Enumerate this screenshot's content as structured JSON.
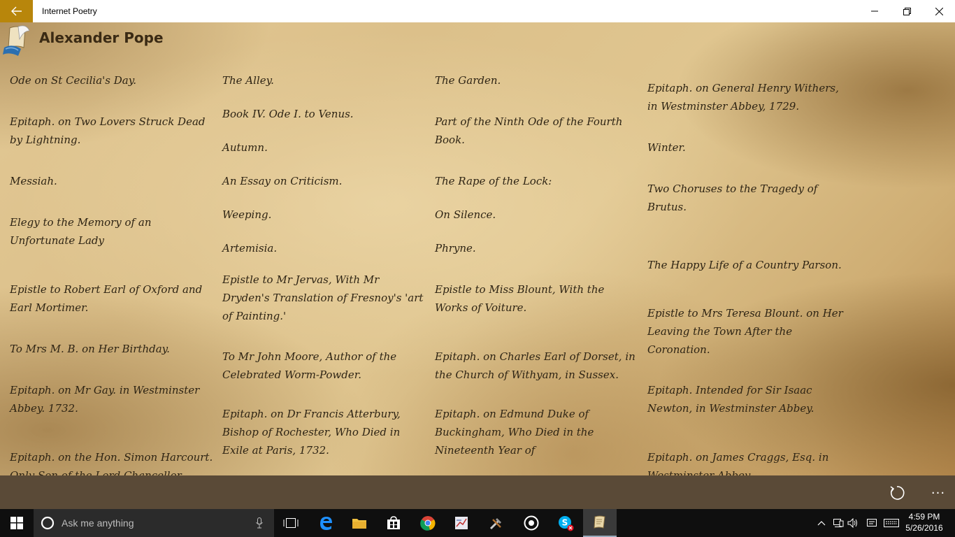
{
  "window": {
    "title": "Internet Poetry"
  },
  "page": {
    "author": "Alexander Pope"
  },
  "columns": [
    [
      {
        "title": "Ode on St Cecilia's Day."
      },
      {
        "title": "Epitaph. on Two Lovers Struck Dead by Lightning."
      },
      {
        "title": "Messiah."
      },
      {
        "title": "Elegy to the Memory of an Unfortunate Lady"
      },
      {
        "title": "Epistle to Robert Earl of Oxford and Earl Mortimer."
      },
      {
        "title": "To Mrs M. B. on Her Birthday."
      },
      {
        "title": "Epitaph. on Mr Gay. in Westminster Abbey. 1732."
      },
      {
        "title": "Epitaph. on the Hon. Simon Harcourt. Only Son of the Lord Chancellor"
      }
    ],
    [
      {
        "title": "The Alley."
      },
      {
        "title": "Book IV. Ode I. to Venus."
      },
      {
        "title": "Autumn."
      },
      {
        "title": "An Essay on Criticism."
      },
      {
        "title": "Weeping."
      },
      {
        "title": "Artemisia."
      },
      {
        "title": "Epistle to Mr Jervas, With Mr Dryden's Translation of Fresnoy's 'art of Painting.'"
      },
      {
        "title": "To Mr John Moore, Author of the Celebrated Worm-Powder."
      },
      {
        "title": "Epitaph. on Dr Francis Atterbury, Bishop of Rochester, Who Died in Exile at Paris, 1732."
      }
    ],
    [
      {
        "title": "The Garden."
      },
      {
        "title": "Part of the Ninth Ode of the Fourth Book."
      },
      {
        "title": "The Rape of the Lock:"
      },
      {
        "title": "On Silence."
      },
      {
        "title": "Phryne."
      },
      {
        "title": "Epistle to Miss Blount, With the Works of Voiture."
      },
      {
        "title": "Epitaph. on Charles Earl of Dorset, in the Church of Withyam, in Sussex."
      },
      {
        "title": "Epitaph. on Edmund Duke of Buckingham, Who Died in the Nineteenth Year of"
      }
    ],
    [
      {
        "title": "Epitaph. on General Henry Withers, in Westminster Abbey, 1729."
      },
      {
        "title": "Winter."
      },
      {
        "title": "Two Choruses to the Tragedy of Brutus."
      },
      {
        "title": "The Happy Life of a Country Parson."
      },
      {
        "title": "Epistle to Mrs Teresa Blount.  on Her Leaving the Town After the Coronation."
      },
      {
        "title": "Epitaph. Intended for Sir Isaac Newton, in Westminster Abbey."
      },
      {
        "title": "Epitaph. on James Craggs, Esq. in Westminster Abbey."
      }
    ]
  ],
  "appbar": {
    "more_label": "..."
  },
  "taskbar": {
    "search_placeholder": "Ask me anything",
    "time": "4:59 PM",
    "date": "5/26/2016",
    "apps": [
      "task-view",
      "edge",
      "file-explorer",
      "store",
      "chrome",
      "app",
      "tools",
      "media",
      "skype",
      "internet-poetry"
    ]
  },
  "colors": {
    "back_button": "#b8860b",
    "appbar": "#5a4a37",
    "taskbar": "#0f0f0f",
    "text": "#2e2414"
  }
}
